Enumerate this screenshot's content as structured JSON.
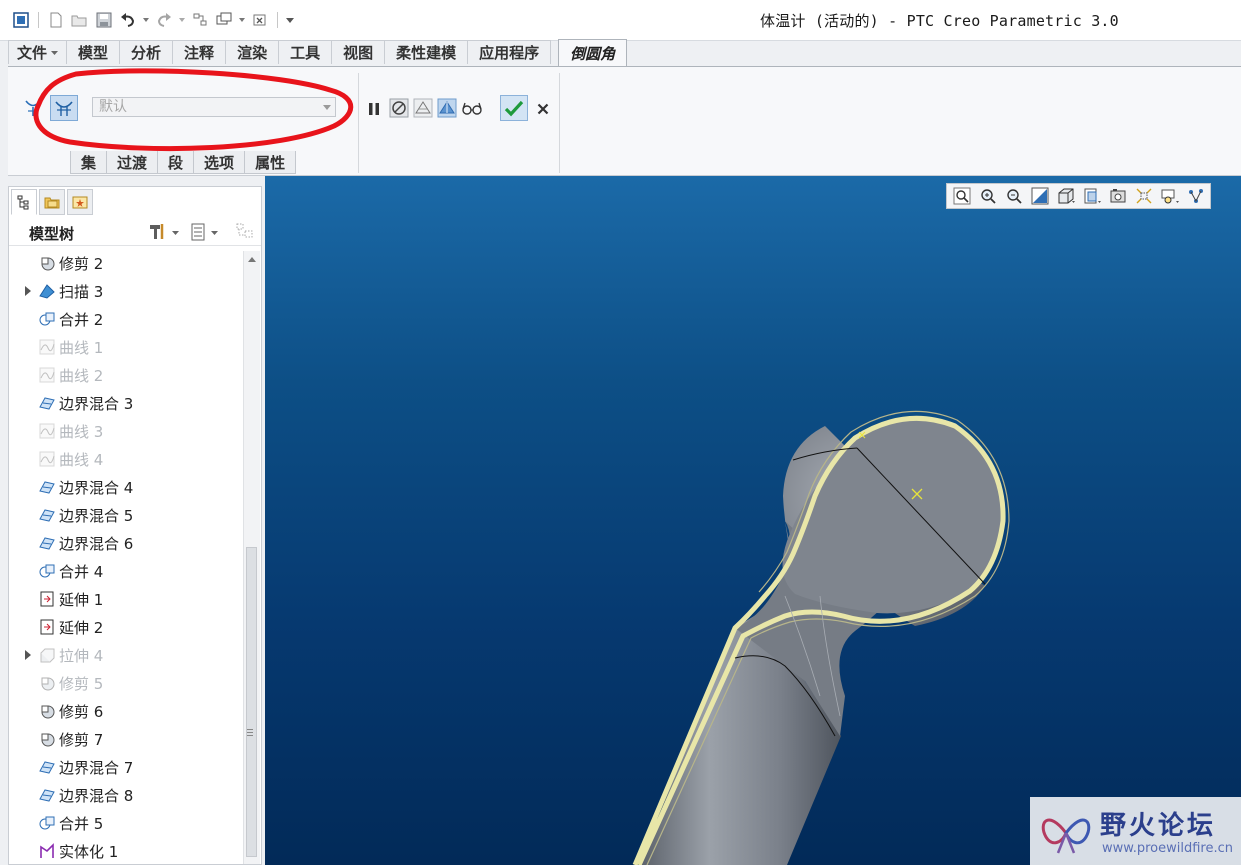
{
  "app": {
    "title": "体温计 (活动的) - PTC Creo Parametric 3.0"
  },
  "ribbon_tabs": [
    {
      "label": "文件"
    },
    {
      "label": "模型"
    },
    {
      "label": "分析"
    },
    {
      "label": "注释"
    },
    {
      "label": "渲染"
    },
    {
      "label": "工具"
    },
    {
      "label": "视图"
    },
    {
      "label": "柔性建模"
    },
    {
      "label": "应用程序"
    },
    {
      "label": "倒圆角"
    }
  ],
  "round": {
    "set_dropdown": "默认",
    "subtabs": [
      "集",
      "过渡",
      "段",
      "选项",
      "属性"
    ]
  },
  "tree": {
    "header": "模型树",
    "items": [
      {
        "label": "修剪 2",
        "icon": "trim-icon",
        "dim": false,
        "expandable": false
      },
      {
        "label": "扫描 3",
        "icon": "sweep-icon",
        "dim": false,
        "expandable": true
      },
      {
        "label": "合并 2",
        "icon": "merge-icon",
        "dim": false,
        "expandable": false
      },
      {
        "label": "曲线 1",
        "icon": "curve-icon",
        "dim": true,
        "expandable": false
      },
      {
        "label": "曲线 2",
        "icon": "curve-icon",
        "dim": true,
        "expandable": false
      },
      {
        "label": "边界混合 3",
        "icon": "boundary-blend-icon",
        "dim": false,
        "expandable": false
      },
      {
        "label": "曲线 3",
        "icon": "curve-icon",
        "dim": true,
        "expandable": false
      },
      {
        "label": "曲线 4",
        "icon": "curve-icon",
        "dim": true,
        "expandable": false
      },
      {
        "label": "边界混合 4",
        "icon": "boundary-blend-icon",
        "dim": false,
        "expandable": false
      },
      {
        "label": "边界混合 5",
        "icon": "boundary-blend-icon",
        "dim": false,
        "expandable": false
      },
      {
        "label": "边界混合 6",
        "icon": "boundary-blend-icon",
        "dim": false,
        "expandable": false
      },
      {
        "label": "合并 4",
        "icon": "merge-icon",
        "dim": false,
        "expandable": false
      },
      {
        "label": "延伸 1",
        "icon": "extend-icon",
        "dim": false,
        "expandable": false
      },
      {
        "label": "延伸 2",
        "icon": "extend-icon",
        "dim": false,
        "expandable": false
      },
      {
        "label": "拉伸 4",
        "icon": "extrude-icon",
        "dim": true,
        "expandable": true
      },
      {
        "label": "修剪 5",
        "icon": "trim-icon",
        "dim": true,
        "expandable": false
      },
      {
        "label": "修剪 6",
        "icon": "trim-icon",
        "dim": false,
        "expandable": false
      },
      {
        "label": "修剪 7",
        "icon": "trim-icon",
        "dim": false,
        "expandable": false
      },
      {
        "label": "边界混合 7",
        "icon": "boundary-blend-icon",
        "dim": false,
        "expandable": false
      },
      {
        "label": "边界混合 8",
        "icon": "boundary-blend-icon",
        "dim": false,
        "expandable": false
      },
      {
        "label": "合并 5",
        "icon": "merge-icon",
        "dim": false,
        "expandable": false
      },
      {
        "label": "实体化 1",
        "icon": "solidify-icon",
        "dim": false,
        "expandable": false
      }
    ]
  },
  "watermark": {
    "title": "野火论坛",
    "url": "www.proewildfire.cn"
  },
  "colors": {
    "annotation_red": "#e8141b",
    "viewport_top": "#1b6aa8",
    "viewport_bottom": "#022a58",
    "model_gray": "#7f858e",
    "round_highlight": "#e8e6a8"
  }
}
